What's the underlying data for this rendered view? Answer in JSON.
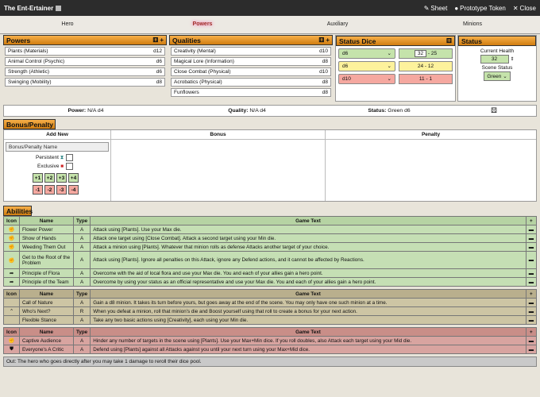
{
  "window": {
    "title": "The Ent-Ertainer",
    "sheet_label": "Sheet",
    "token_label": "Prototype Token",
    "close_label": "Close"
  },
  "tabs": [
    "Hero",
    "Powers",
    "Auxiliary",
    "Minions"
  ],
  "powers": {
    "header": "Powers",
    "rows": [
      {
        "name": "Plants (Materials)",
        "die": "d12"
      },
      {
        "name": "Animal Control (Psychic)",
        "die": "d6"
      },
      {
        "name": "Strength (Athletic)",
        "die": "d6"
      },
      {
        "name": "Swinging (Mobility)",
        "die": "d8"
      }
    ]
  },
  "qualities": {
    "header": "Qualities",
    "rows": [
      {
        "name": "Creativity (Mental)",
        "die": "d10"
      },
      {
        "name": "Magical Lore (Information)",
        "die": "d8"
      },
      {
        "name": "Close Combat (Physical)",
        "die": "d10"
      },
      {
        "name": "Acrobatics (Physical)",
        "die": "d8"
      },
      {
        "name": "Funflowers",
        "die": "d8"
      }
    ]
  },
  "status_dice": {
    "header": "Status Dice",
    "rows": [
      {
        "die": "d6",
        "range_a": "32",
        "range_b": "- 25",
        "color": "#c5e3ab"
      },
      {
        "die": "d6",
        "range": "24 - 12",
        "color": "#fdf29c"
      },
      {
        "die": "d10",
        "range": "11 - 1",
        "color": "#f5a8a0"
      }
    ]
  },
  "status": {
    "header": "Status",
    "health_label": "Current Health",
    "health_value": "32",
    "scene_label": "Scene Status",
    "scene_value": "Green"
  },
  "summary": {
    "power_label": "Power:",
    "power_value": "N/A d4",
    "quality_label": "Quality:",
    "quality_value": "N/A d4",
    "status_label": "Status:",
    "status_value": "Green d6"
  },
  "bonus_penalty": {
    "header": "Bonus/Penalty",
    "col_add_new": "Add New",
    "col_bonus": "Bonus",
    "col_penalty": "Penalty",
    "name_placeholder": "Bonus/Penalty Name",
    "persistent_label": "Persistent",
    "exclusive_label": "Exclusive",
    "bonus_buttons": [
      "+1",
      "+2",
      "+3",
      "+4"
    ],
    "penalty_buttons": [
      "-1",
      "-2",
      "-3",
      "-4"
    ]
  },
  "abilities": {
    "header": "Abilities",
    "columns": {
      "icon": "Icon",
      "name": "Name",
      "type": "Type",
      "text": "Game Text"
    },
    "green": [
      {
        "icon": "fist-icon",
        "name": "Flower Power",
        "type": "A",
        "text": "Attack using [Plants]. Use your Max die."
      },
      {
        "icon": "fist-icon",
        "name": "Show of Hands",
        "type": "A",
        "text": "Attack one target using [Close Combat]. Attack a second target using your Min die."
      },
      {
        "icon": "fist-icon",
        "name": "Weeding Them Out",
        "type": "A",
        "text": "Attack a minion using [Plants]. Whatever that minion rolls as defense Attacks another target of your choice."
      },
      {
        "icon": "fist-icon",
        "name": "Get to the Root of the Problem",
        "type": "A",
        "text": "Attack using [Plants]. Ignore all penalties on this Attack, ignore any Defend actions, and it cannot be affected by Reactions."
      },
      {
        "icon": "arrow-icon",
        "name": "Principle of Flora",
        "type": "A",
        "text": "Overcome with the aid of local flora and use your Max die. You and each of your allies gain a hero point."
      },
      {
        "icon": "arrow-icon",
        "name": "Principle of the Team",
        "type": "A",
        "text": "Overcome by using your status as an official representative and use your Max die. You and each of your allies gain a hero point."
      }
    ],
    "yellow": [
      {
        "icon": "",
        "name": "Call of Nature",
        "type": "A",
        "text": "Gain a d8 minion. It takes its turn before yours, but goes away at the end of the scene. You may only have one such minion at a time."
      },
      {
        "icon": "boost-icon",
        "name": "Who's Next?",
        "type": "R",
        "text": "When you defeat a minion, roll that minion's die and Boost yourself using that roll to create a bonus for your next action."
      },
      {
        "icon": "",
        "name": "Flexible Stance",
        "type": "A",
        "text": "Take any two basic actions using [Creativity], each using your Min die."
      }
    ],
    "red": [
      {
        "icon": "fist-down-icon",
        "name": "Captive Audience",
        "type": "A",
        "text": "Hinder any number of targets in the scene using [Plants]. Use your Max+Min dice. If you roll doubles, also Attack each target using your Mid die."
      },
      {
        "icon": "shield-icon",
        "name": "Everyone's A Critic",
        "type": "A",
        "text": "Defend using [Plants] against all Attacks against you until your next turn using your Max+Mid dice."
      }
    ],
    "out_text": "Out: The hero who goes directly after you may take 1 damage to reroll their dice pool."
  }
}
